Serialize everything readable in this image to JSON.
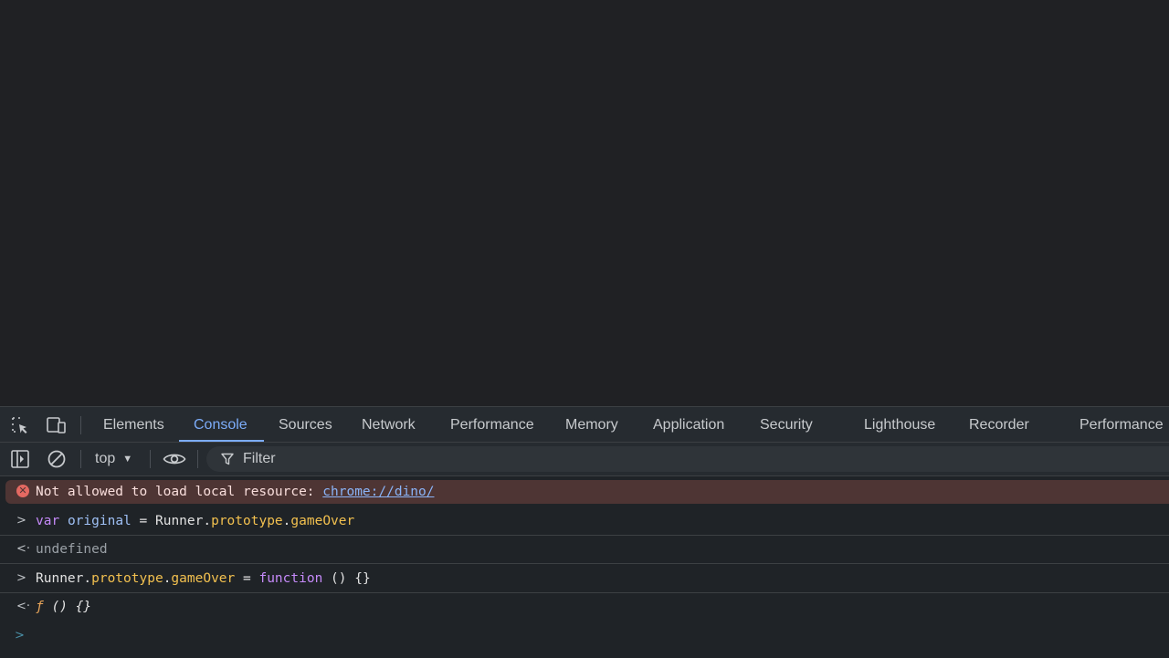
{
  "devtools": {
    "tabs": [
      {
        "label": "Elements",
        "active": false
      },
      {
        "label": "Console",
        "active": true
      },
      {
        "label": "Sources",
        "active": false
      },
      {
        "label": "Network",
        "active": false
      },
      {
        "label": "Performance",
        "active": false
      },
      {
        "label": "Memory",
        "active": false
      },
      {
        "label": "Application",
        "active": false
      },
      {
        "label": "Security",
        "active": false
      },
      {
        "label": "Lighthouse",
        "active": false
      },
      {
        "label": "Recorder",
        "active": false
      },
      {
        "label": "Performance",
        "active": false
      }
    ],
    "icons": {
      "inspect": "inspect-element-icon",
      "device": "device-toolbar-icon"
    }
  },
  "toolbar": {
    "context": "top",
    "filter_label": "Filter",
    "icons": [
      "sidebar-toggle-icon",
      "clear-console-icon",
      "eye-icon",
      "filter-icon"
    ]
  },
  "console": {
    "error": {
      "prefix": "Not allowed to load local resource: ",
      "link": "chrome://dino/"
    },
    "line1": {
      "kw": "var",
      "name": "original",
      "op": " = ",
      "obj": "Runner.",
      "prop1": "prototype",
      "dot": ".",
      "prop2": "gameOver"
    },
    "result1": "undefined",
    "line2": {
      "obj": "Runner.",
      "prop1": "prototype",
      "dot": ".",
      "prop2": "gameOver",
      "op": " = ",
      "kw": "function",
      "rest": " () {}"
    },
    "result2": {
      "symbol": "ƒ",
      "sig": " () {}"
    }
  },
  "colors": {
    "background": "#202124",
    "accent": "#7cacf8",
    "error_bg": "#4e3534",
    "keyword": "#c58af9",
    "property": "#f2c04f"
  }
}
